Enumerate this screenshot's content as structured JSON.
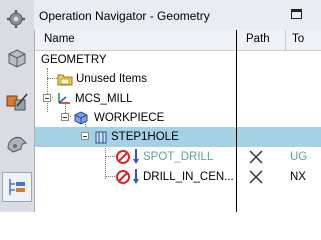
{
  "panel": {
    "title": "Operation Navigator - Geometry"
  },
  "columns": {
    "name": "Name",
    "path": "Path",
    "tool": "To"
  },
  "tree": {
    "geometry": "GEOMETRY",
    "unused": "Unused Items",
    "mcs": "MCS_MILL",
    "workpiece": "WORKPIECE",
    "step1hole": "STEP1HOLE",
    "op1": {
      "name": "SPOT_DRILL",
      "tool": "UG",
      "path_icon": "x-mark-icon"
    },
    "op2": {
      "name": "DRILL_IN_CEN...",
      "tool": "NX",
      "path_icon": "x-mark-icon"
    }
  },
  "colors": {
    "selection": "#a4d2e4",
    "inactive_text": "#5fa38c",
    "no_symbol": "#d8262b",
    "drill": "#2e57c9"
  }
}
